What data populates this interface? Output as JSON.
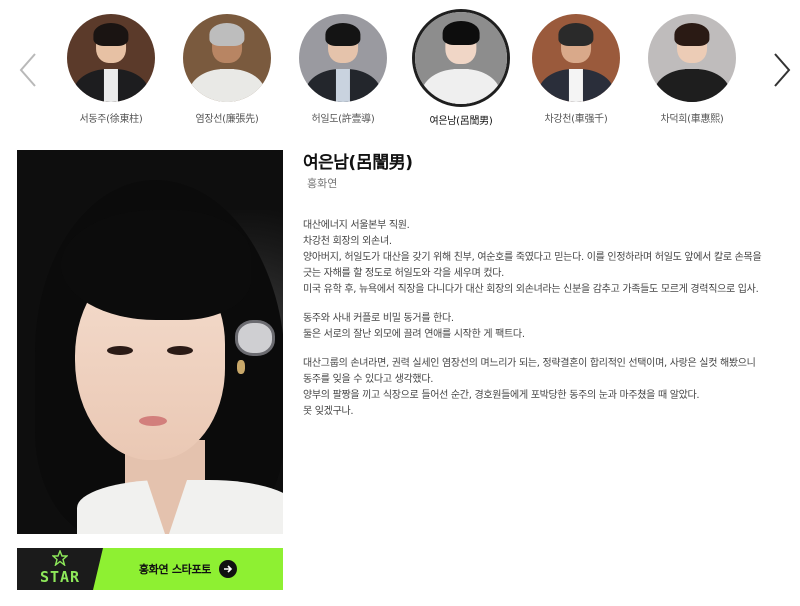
{
  "carousel": {
    "prev_icon": "chevron-left-icon",
    "next_icon": "chevron-right-icon",
    "items": [
      {
        "label": "서동주(徐東柱)",
        "bg": "#5b3a2a",
        "skin": "#e7c1a4",
        "hair": "#1a1412",
        "body": "#1d1d1f",
        "shirt": "#ececec"
      },
      {
        "label": "염장선(廉張先)",
        "bg": "#7a5a3e",
        "skin": "#b88563",
        "hair": "#bdbdbd",
        "body": "#e9e9e6",
        "shirt": "#e9e9e6"
      },
      {
        "label": "허일도(許壹導)",
        "bg": "#9a9aa0",
        "skin": "#e5c3ab",
        "hair": "#141414",
        "body": "#23262c",
        "shirt": "#c9d3df"
      },
      {
        "label": "여은남(呂誾男)",
        "bg": "#8d8d8d",
        "skin": "#f0d6c6",
        "hair": "#0d0d0d",
        "body": "#efefef",
        "shirt": "#efefef"
      },
      {
        "label": "차강천(車强千)",
        "bg": "#9a5a3c",
        "skin": "#d9a98a",
        "hair": "#2a2a2a",
        "body": "#2a2e3a",
        "shirt": "#f4f4f4"
      },
      {
        "label": "차덕희(車惠熙)",
        "bg": "#bfbcbc",
        "skin": "#ecccb6",
        "hair": "#2a1a14",
        "body": "#1e1e1e",
        "shirt": "#1e1e1e"
      }
    ],
    "active_index": 3
  },
  "profile": {
    "character_name": "여은남(呂誾男)",
    "actor_name": "홍화연",
    "portrait_icon": "portrait-photo",
    "description": [
      [
        "대산에너지 서울본부 직원.",
        "차강천 회장의 외손녀.",
        "양아버지, 허일도가 대산을 갖기 위해 친부, 여순호를 죽였다고 믿는다. 이를 인정하라며 허일도 앞에서 칼로 손목을 긋는 자해를 할 정도로 허일도와 각을 세우며 컸다.",
        "미국 유학 후, 뉴욕에서 직장을 다니다가 대산 회장의 외손녀라는 신분을 감추고 가족들도 모르게 경력직으로 입사."
      ],
      [
        "동주와 사내 커플로 비밀 동거를 한다.",
        "둘은 서로의 잘난 외모에 끌려 연애를 시작한 게 팩트다."
      ],
      [
        "대산그룹의 손녀라면, 권력 실세인 염장선의 며느리가 되는, 정략결혼이 합리적인 선택이며, 사랑은 실컷 해봤으니 동주를 잊을 수 있다고 생각했다.",
        "양부의 팔짱을 끼고 식장으로 들어선 순간, 경호원들에게 포박당한 동주의 눈과 마주쳤을 때 알았다.",
        "못 잊겠구나."
      ]
    ]
  },
  "star_banner": {
    "brand": "STAR",
    "label": "홍화연 스타포토",
    "brand_color": "#8ee85a",
    "accent_color": "#8ef032"
  }
}
